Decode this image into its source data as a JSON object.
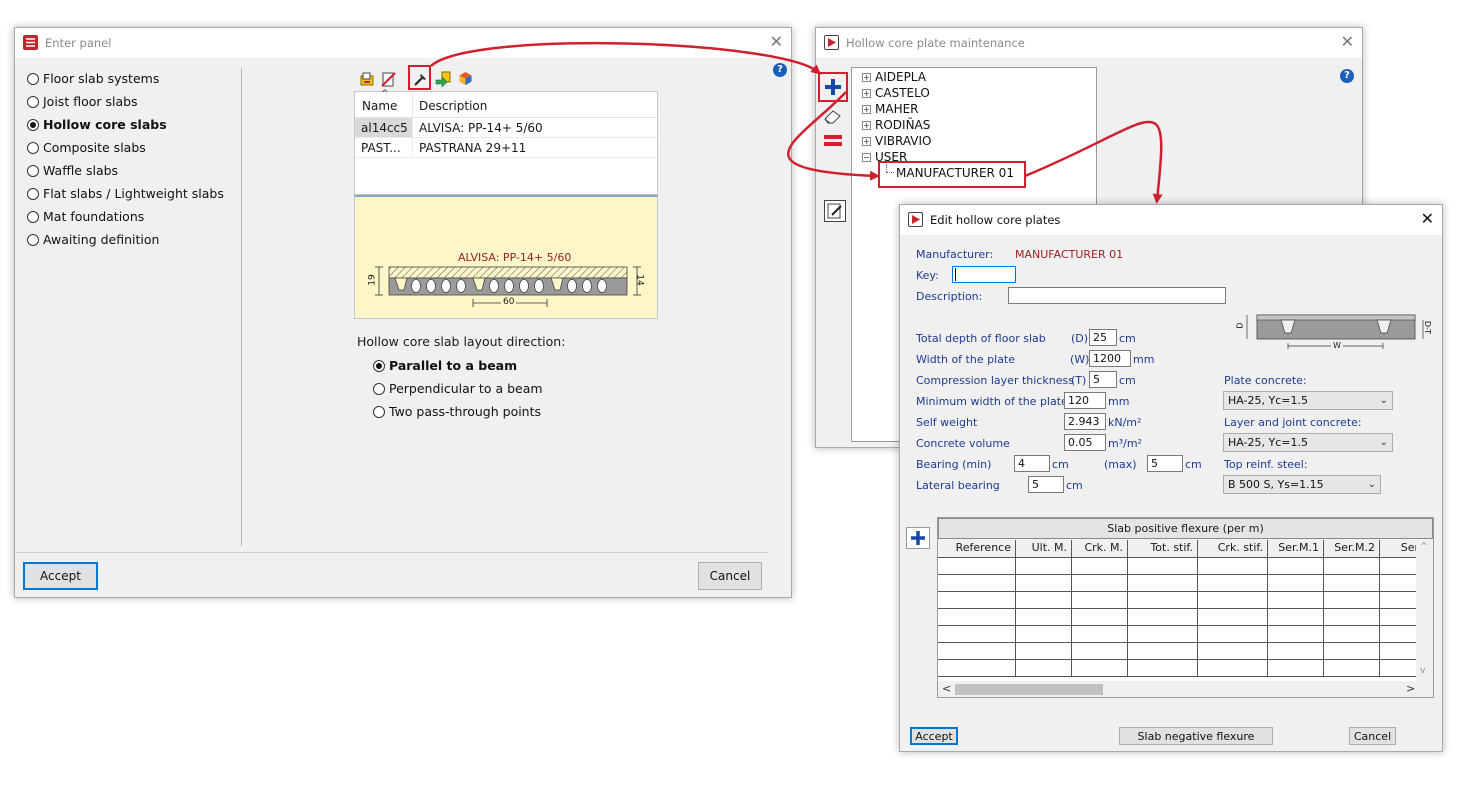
{
  "enter_panel": {
    "title": "Enter panel",
    "slab_types": [
      {
        "label": "Floor slab systems",
        "selected": false
      },
      {
        "label": "Joist floor slabs",
        "selected": false
      },
      {
        "label": "Hollow core slabs",
        "selected": true
      },
      {
        "label": "Composite slabs",
        "selected": false
      },
      {
        "label": "Waffle slabs",
        "selected": false
      },
      {
        "label": "Flat slabs / Lightweight slabs",
        "selected": false
      },
      {
        "label": "Mat foundations",
        "selected": false
      },
      {
        "label": "Awaiting definition",
        "selected": false
      }
    ],
    "table": {
      "columns": [
        "Name",
        "Description"
      ],
      "rows": [
        {
          "name": "al14cc5",
          "description": "ALVISA: PP-14+ 5/60"
        },
        {
          "name": "PAST...",
          "description": "PASTRANA 29+11"
        }
      ]
    },
    "preview": {
      "title": "ALVISA: PP-14+ 5/60",
      "dim_left": "19",
      "dim_right": "14",
      "dim_bottom": "60"
    },
    "layout_direction": {
      "label": "Hollow core slab layout direction:",
      "options": [
        {
          "label": "Parallel to a beam",
          "selected": true
        },
        {
          "label": "Perpendicular to a beam",
          "selected": false
        },
        {
          "label": "Two pass-through points",
          "selected": false
        }
      ]
    },
    "accept_label": "Accept",
    "cancel_label": "Cancel",
    "help": "?"
  },
  "maintenance": {
    "title": "Hollow core plate maintenance",
    "tree": [
      {
        "label": "AIDEPLA",
        "toggle": "+"
      },
      {
        "label": "CASTELO",
        "toggle": "+"
      },
      {
        "label": "MAHER",
        "toggle": "+"
      },
      {
        "label": "RODIÑAS",
        "toggle": "+"
      },
      {
        "label": "VIBRAVIO",
        "toggle": "+"
      },
      {
        "label": "USER",
        "toggle": "−"
      }
    ],
    "child": "MANUFACTURER 01",
    "help": "?"
  },
  "edit": {
    "title": "Edit hollow core plates",
    "manufacturer_label": "Manufacturer:",
    "manufacturer_value": "MANUFACTURER 01",
    "key_label": "Key:",
    "key_value": "",
    "description_label": "Description:",
    "description_value": "",
    "fields": [
      {
        "label": "Total depth of floor slab",
        "sym": "(D)",
        "value": "25",
        "unit": "cm"
      },
      {
        "label": "Width of the plate",
        "sym": "(W)",
        "value": "1200",
        "unit": "mm"
      },
      {
        "label": "Compression layer thickness",
        "sym": "(T)",
        "value": "5",
        "unit": "cm"
      },
      {
        "label": "Minimum width of the plate",
        "sym": "",
        "value": "120",
        "unit": "mm"
      },
      {
        "label": "Self weight",
        "sym": "",
        "value": "2.943",
        "unit": "kN/m²"
      },
      {
        "label": "Concrete volume",
        "sym": "",
        "value": "0.05",
        "unit": "m³/m²"
      }
    ],
    "bearing": {
      "label": "Bearing (min)",
      "min_value": "4",
      "min_unit": "cm",
      "max_label": "(max)",
      "max_value": "5",
      "max_unit": "cm"
    },
    "lateral": {
      "label": "Lateral bearing",
      "value": "5",
      "unit": "cm"
    },
    "plate_concrete": {
      "label": "Plate concrete:",
      "value": "HA-25, Yc=1.5"
    },
    "layer_concrete": {
      "label": "Layer and joint concrete:",
      "value": "HA-25, Yc=1.5"
    },
    "top_steel": {
      "label": "Top reinf. steel:",
      "value": "B 500 S, Ys=1.15"
    },
    "diagram": {
      "d": "D",
      "w": "W",
      "dt": "D-T"
    },
    "grid": {
      "title": "Slab positive flexure (per m)",
      "columns": [
        "Reference",
        "Ult. M.",
        "Crk. M.",
        "Tot. stif.",
        "Crk. stif.",
        "Ser.M.1",
        "Ser.M.2",
        "Ser.M"
      ]
    },
    "accept_label": "Accept",
    "negative_label": "Slab negative flexure",
    "cancel_label": "Cancel"
  }
}
